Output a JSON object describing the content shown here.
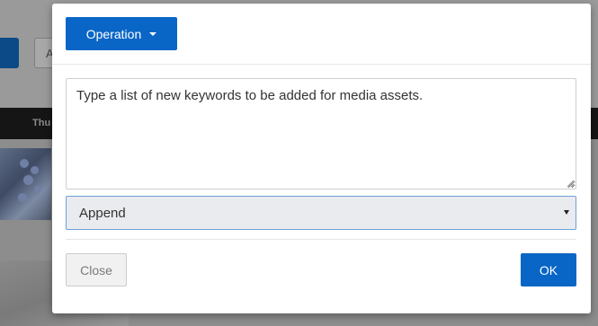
{
  "background": {
    "search_input_fragment": "A",
    "nav_label_fragment": "Thu"
  },
  "modal": {
    "operation_button_label": "Operation",
    "operation_button_icon": "caret-down-icon",
    "keywords_textarea": {
      "value": "",
      "placeholder": "Type a list of new keywords to be added for media assets."
    },
    "mode_select": {
      "selected": "Append",
      "icon": "select-arrow-icon"
    },
    "close_button_label": "Close",
    "ok_button_label": "OK"
  },
  "colors": {
    "primary": "#0a66c6",
    "overlay": "#8c8c8c",
    "select_bg": "#eaebee",
    "select_border": "#6ea0d8"
  }
}
